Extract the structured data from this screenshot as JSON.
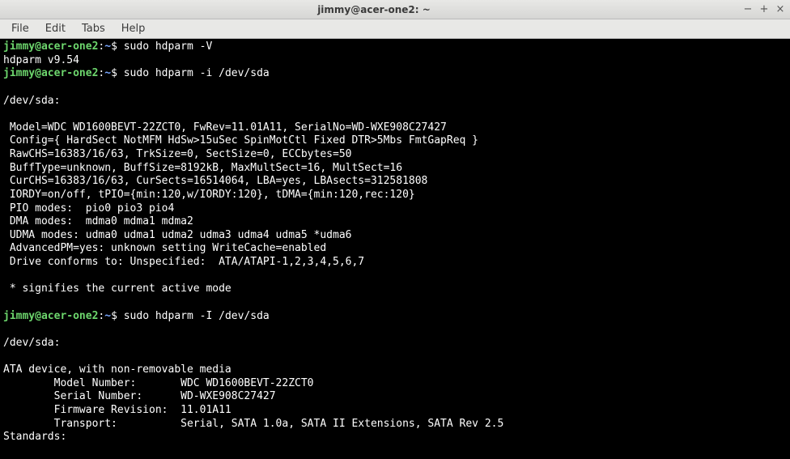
{
  "window": {
    "title": "jimmy@acer-one2: ~"
  },
  "menu": {
    "file": "File",
    "edit": "Edit",
    "tabs": "Tabs",
    "help": "Help"
  },
  "prompt": {
    "user": "jimmy@acer-one2",
    "colon": ":",
    "path": "~",
    "dollar": "$"
  },
  "cmd1": "sudo hdparm -V",
  "out1": "hdparm v9.54",
  "cmd2": "sudo hdparm -i /dev/sda",
  "block2": {
    "l0": "",
    "l1": "/dev/sda:",
    "l2": "",
    "l3": " Model=WDC WD1600BEVT-22ZCT0, FwRev=11.01A11, SerialNo=WD-WXE908C27427",
    "l4": " Config={ HardSect NotMFM HdSw>15uSec SpinMotCtl Fixed DTR>5Mbs FmtGapReq }",
    "l5": " RawCHS=16383/16/63, TrkSize=0, SectSize=0, ECCbytes=50",
    "l6": " BuffType=unknown, BuffSize=8192kB, MaxMultSect=16, MultSect=16",
    "l7": " CurCHS=16383/16/63, CurSects=16514064, LBA=yes, LBAsects=312581808",
    "l8": " IORDY=on/off, tPIO={min:120,w/IORDY:120}, tDMA={min:120,rec:120}",
    "l9": " PIO modes:  pio0 pio3 pio4",
    "l10": " DMA modes:  mdma0 mdma1 mdma2",
    "l11": " UDMA modes: udma0 udma1 udma2 udma3 udma4 udma5 *udma6",
    "l12": " AdvancedPM=yes: unknown setting WriteCache=enabled",
    "l13": " Drive conforms to: Unspecified:  ATA/ATAPI-1,2,3,4,5,6,7",
    "l14": "",
    "l15": " * signifies the current active mode",
    "l16": ""
  },
  "cmd3": "sudo hdparm -I /dev/sda",
  "block3": {
    "l0": "",
    "l1": "/dev/sda:",
    "l2": "",
    "l3": "ATA device, with non-removable media",
    "l4": "        Model Number:       WDC WD1600BEVT-22ZCT0",
    "l5": "        Serial Number:      WD-WXE908C27427",
    "l6": "        Firmware Revision:  11.01A11",
    "l7": "        Transport:          Serial, SATA 1.0a, SATA II Extensions, SATA Rev 2.5",
    "l8": "Standards:"
  }
}
